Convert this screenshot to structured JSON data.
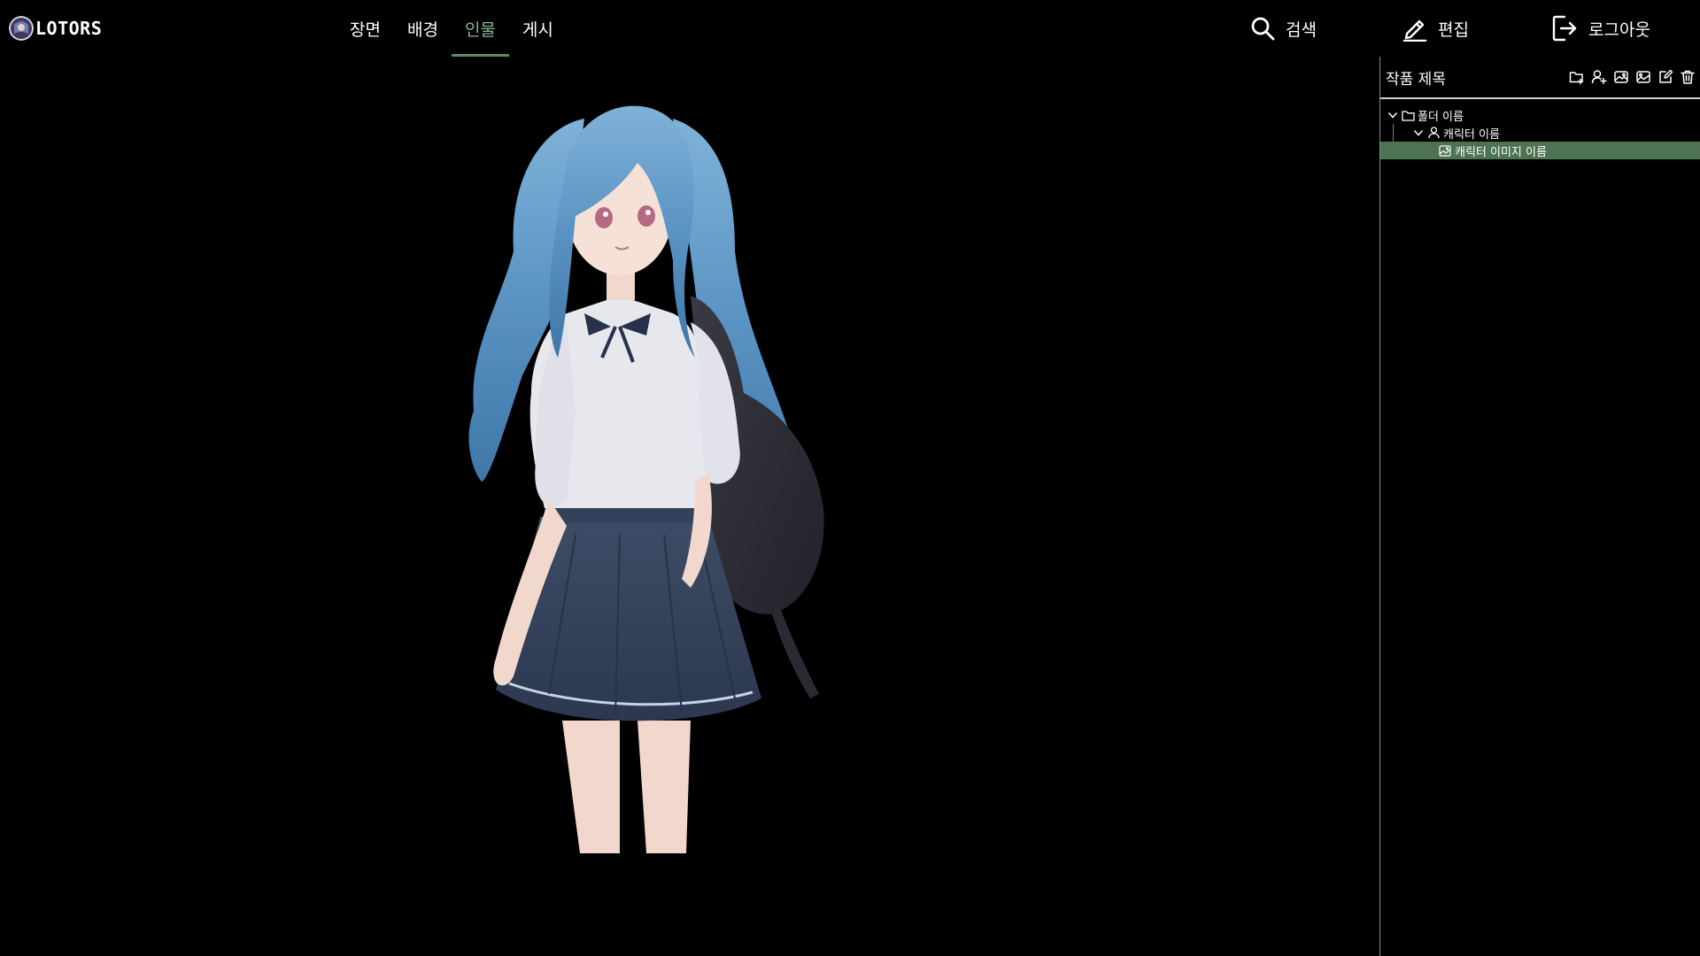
{
  "app": {
    "logo_text": "LOTORS"
  },
  "nav": {
    "tabs": [
      {
        "label": "장면",
        "active": false
      },
      {
        "label": "배경",
        "active": false
      },
      {
        "label": "인물",
        "active": true
      },
      {
        "label": "게시",
        "active": false
      }
    ]
  },
  "actions": {
    "search_label": "검색",
    "edit_label": "편집",
    "logout_label": "로그아웃"
  },
  "panel": {
    "title": "작품 제목",
    "tools": [
      "new-folder-icon",
      "add-character-icon",
      "add-image-icon",
      "replace-image-icon",
      "edit-icon",
      "trash-icon"
    ],
    "tree": {
      "folder": {
        "label": "폴더 이름",
        "expanded": true
      },
      "character": {
        "label": "캐릭터 이름",
        "expanded": true
      },
      "image": {
        "label": "캐릭터 이미지 이름",
        "selected": true
      }
    }
  },
  "colors": {
    "background": "#000000",
    "accent": "#89b592",
    "selection": "#4d7352"
  }
}
